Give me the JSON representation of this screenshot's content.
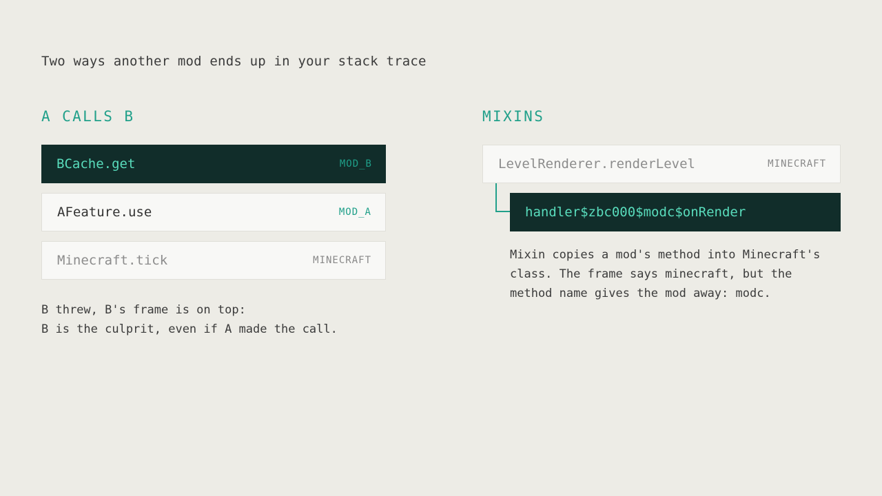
{
  "title": "Two ways another mod ends up in your stack trace",
  "left": {
    "heading": "A CALLS B",
    "frames": [
      {
        "method": "BCache.get",
        "tag": "MOD_B"
      },
      {
        "method": "AFeature.use",
        "tag": "MOD_A"
      },
      {
        "method": "Minecraft.tick",
        "tag": "MINECRAFT"
      }
    ],
    "note_line1": "B threw, B's frame is on top:",
    "note_line2": "B is the culprit, even if A made the call."
  },
  "right": {
    "heading": "MIXINS",
    "outer_frame": {
      "method": "LevelRenderer.renderLevel",
      "tag": "MINECRAFT"
    },
    "inner_frame": {
      "method": "handler$zbc000$modc$onRender"
    },
    "note_line1": "Mixin copies a mod's method into Minecraft's",
    "note_line2": "class. The frame says minecraft, but the",
    "note_line3": "method name gives the mod away: modc."
  },
  "colors": {
    "background": "#edece6",
    "accent": "#21a08a",
    "dark_frame": "#112d2a",
    "highlight_text": "#59dcbc"
  }
}
